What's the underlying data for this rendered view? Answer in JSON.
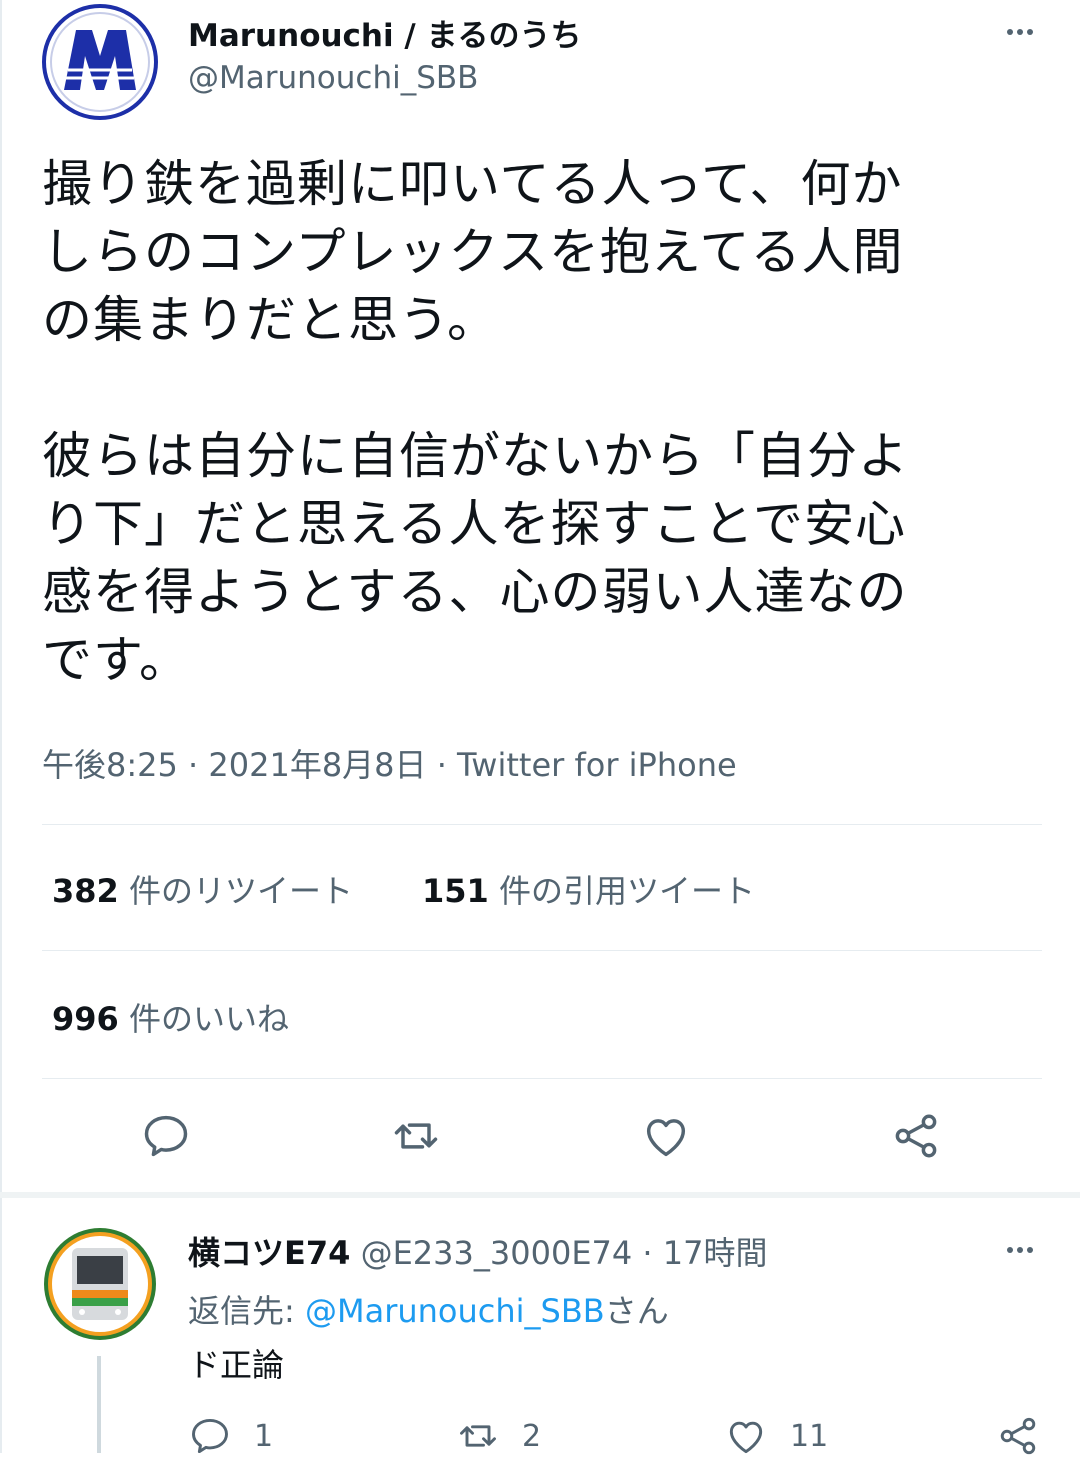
{
  "tweet": {
    "author_name": "Marunouchi / まるのうち",
    "author_handle": "@Marunouchi_SBB",
    "paragraph_1": "撮り鉄を過剰に叩いてる人って、何か\nしらのコンプレックスを抱えてる人間\nの集まりだと思う。",
    "paragraph_2": "彼らは自分に自信がないから「自分よ\nり下」だと思える人を探すことで安心\n感を得ようとする、心の弱い人達なの\nです。",
    "meta": "午後8:25 · 2021年8月8日 · Twitter for iPhone",
    "retweet_count": "382",
    "retweet_label": " 件のリツイート",
    "quote_count": "151",
    "quote_label": " 件の引用ツイート",
    "like_count": "996",
    "like_label": " 件のいいね"
  },
  "reply": {
    "author_name": "横コツE74",
    "meta": " @E233_3000E74 · 17時間",
    "reply_prefix": "返信先: ",
    "reply_to_handle": "@Marunouchi_SBB",
    "reply_suffix": "さん",
    "text": "ド正論",
    "reply_count": "1",
    "retweet_count": "2",
    "like_count": "11"
  },
  "colors": {
    "text": "#0f1419",
    "secondary": "#536471",
    "link": "#1d9bf0",
    "divider": "#e6ecf0",
    "avatar_blue": "#1d2fa8"
  },
  "icons": [
    "more-icon",
    "reply-icon",
    "retweet-icon",
    "like-icon",
    "share-icon"
  ]
}
